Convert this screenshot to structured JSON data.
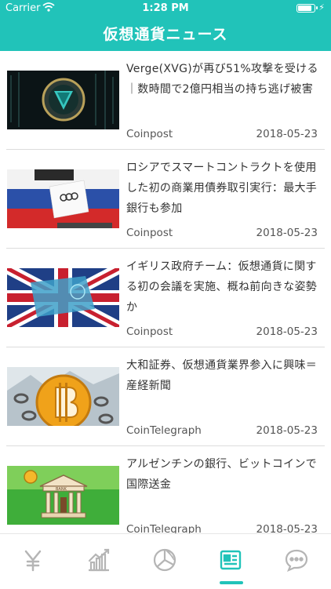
{
  "status_bar": {
    "carrier": "Carrier",
    "time": "1:28 PM",
    "charging": "⚡"
  },
  "header": {
    "title": "仮想通貨ニュース"
  },
  "news": [
    {
      "headline": "Verge(XVG)が再び51%攻撃を受ける｜数時間で2億円相当の持ち逃げ被害",
      "source": "Coinpost",
      "date": "2018-05-23"
    },
    {
      "headline": "ロシアでスマートコントラクトを使用した初の商業用債券取引実行：最大手銀行も参加",
      "source": "Coinpost",
      "date": "2018-05-23"
    },
    {
      "headline": "イギリス政府チーム：仮想通貨に関する初の会議を実施、概ね前向きな姿勢か",
      "source": "Coinpost",
      "date": "2018-05-23"
    },
    {
      "headline": "大和証券、仮想通貨業界参入に興味＝産経新聞",
      "source": "CoinTelegraph",
      "date": "2018-05-23"
    },
    {
      "headline": "アルゼンチンの銀行、ビットコインで国際送金",
      "source": "CoinTelegraph",
      "date": "2018-05-23",
      "thumb_text": "BANK"
    }
  ],
  "tabs": [
    {
      "icon": "yen-icon"
    },
    {
      "icon": "chart-icon"
    },
    {
      "icon": "pie-icon"
    },
    {
      "icon": "news-icon",
      "active": true
    },
    {
      "icon": "chat-icon"
    }
  ],
  "colors": {
    "accent": "#21c3b9",
    "inactive_icon": "#b5b5b5"
  }
}
